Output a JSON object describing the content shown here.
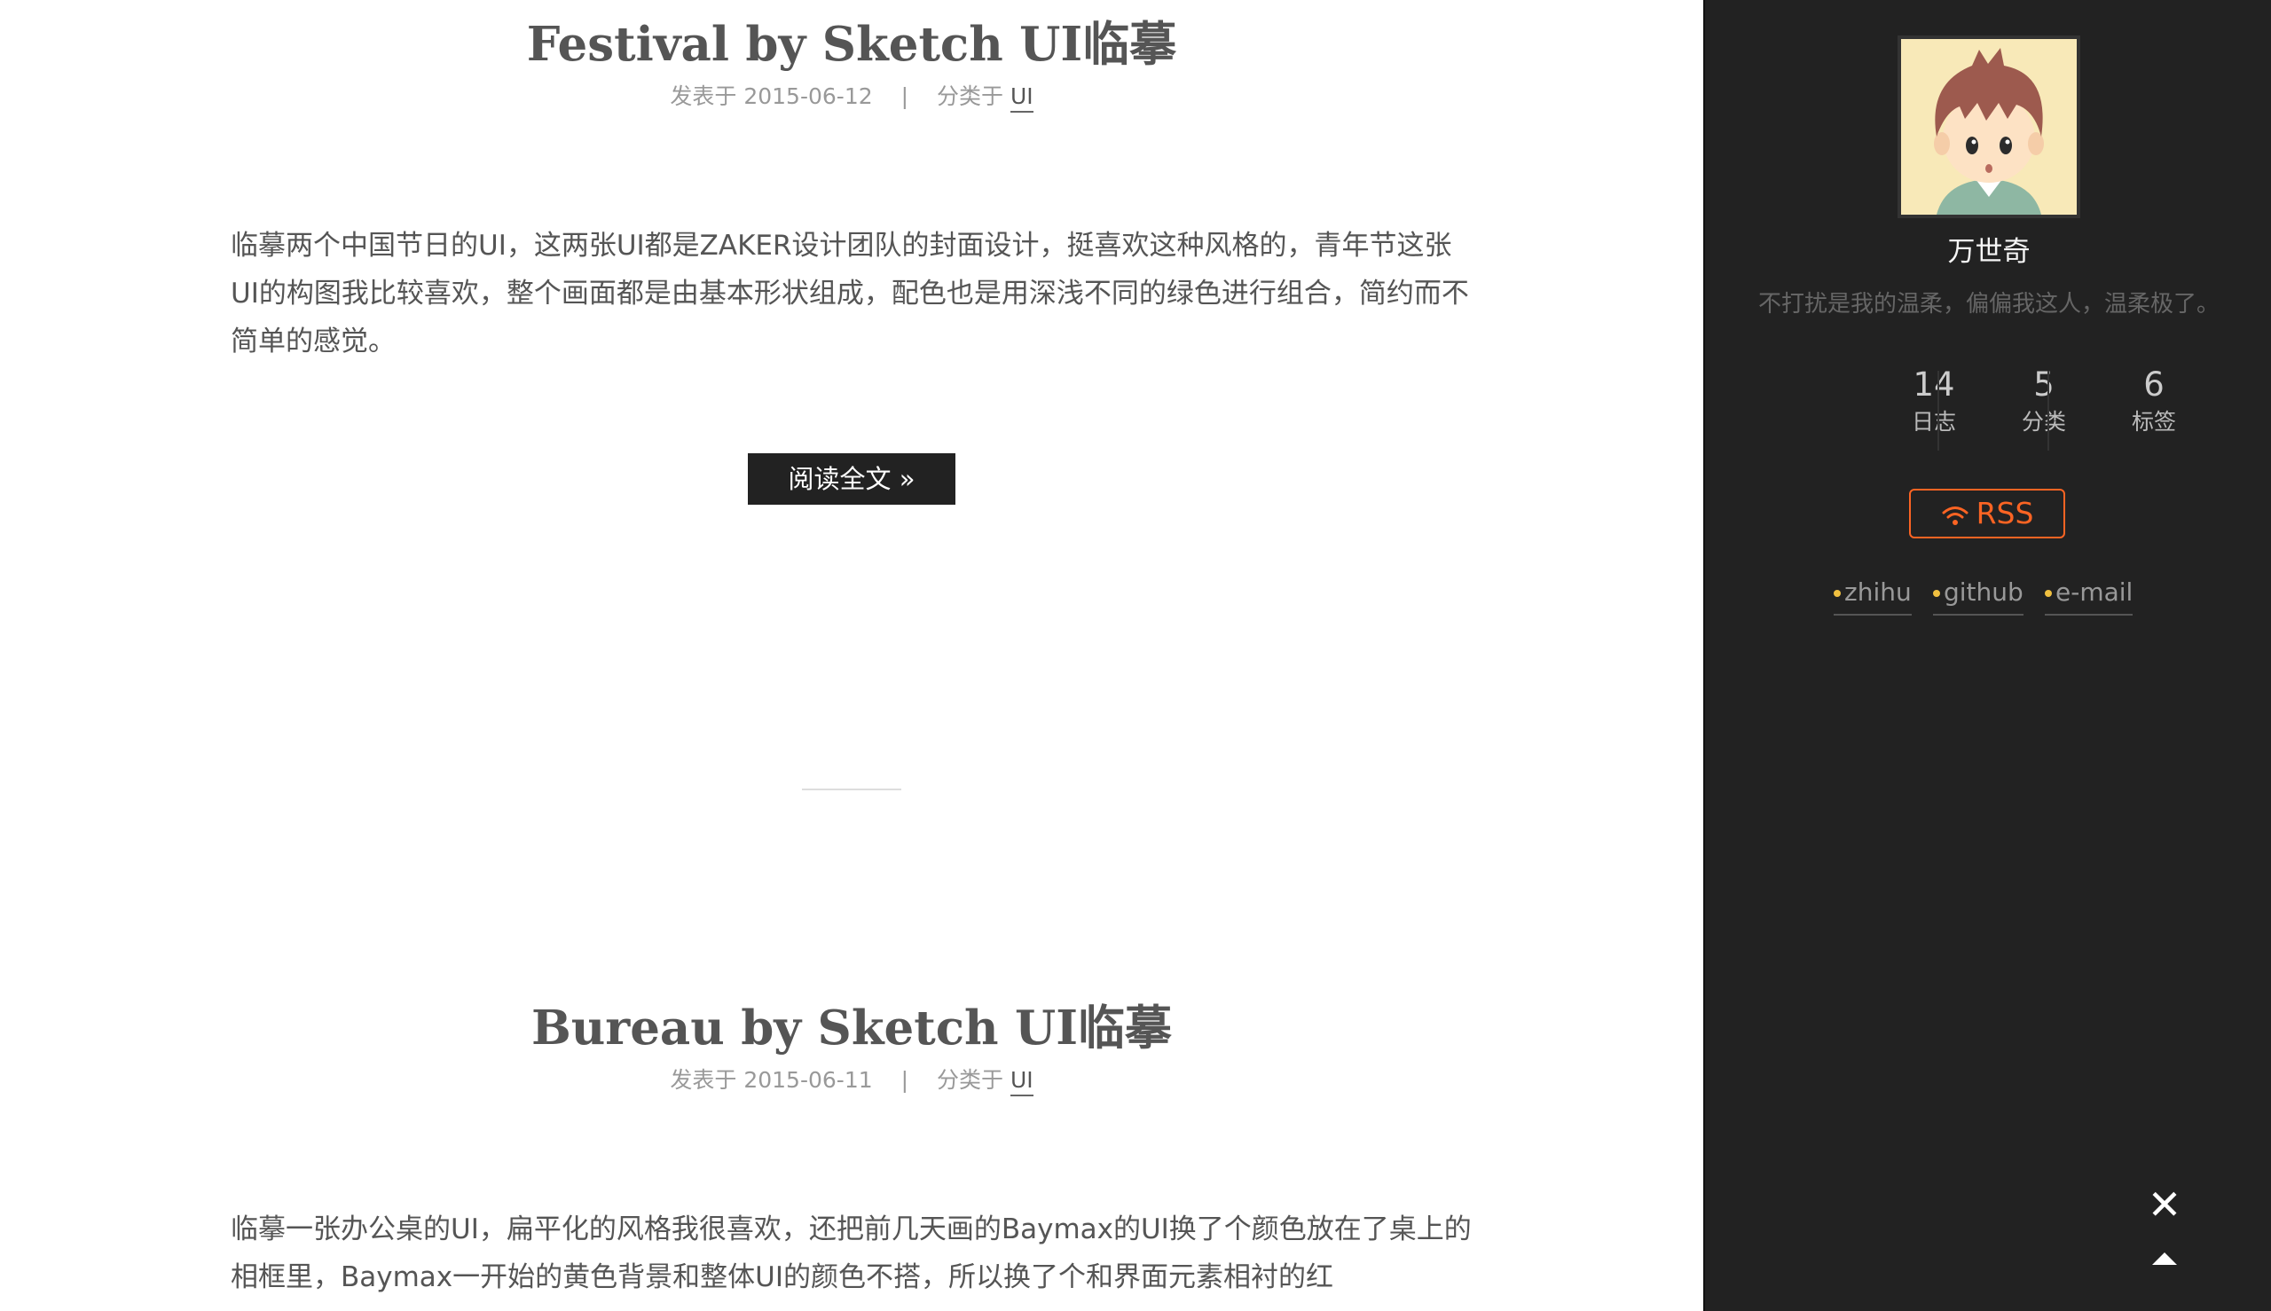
{
  "posts": [
    {
      "title": "Festival by Sketch UI临摹",
      "meta_prefix": "发表于",
      "date": "2015-06-12",
      "meta_sep": "|",
      "category_prefix": "分类于",
      "category": "UI",
      "body": "临摹两个中国节日的UI，这两张UI都是ZAKER设计团队的封面设计，挺喜欢这种风格的，青年节这张UI的构图我比较喜欢，整个画面都是由基本形状组成，配色也是用深浅不同的绿色进行组合，简约而不简单的感觉。",
      "read_more": "阅读全文 »"
    },
    {
      "title": "Bureau by Sketch UI临摹",
      "meta_prefix": "发表于",
      "date": "2015-06-11",
      "meta_sep": "|",
      "category_prefix": "分类于",
      "category": "UI",
      "body": "临摹一张办公桌的UI，扁平化的风格我很喜欢，还把前几天画的Baymax的UI换了个颜色放在了桌上的相框里，Baymax一开始的黄色背景和整体UI的颜色不搭，所以换了个和界面元素相衬的红"
    }
  ],
  "sidebar": {
    "author_name": "万世奇",
    "author_desc": "不打扰是我的温柔，偏偏我这人，温柔极了。",
    "stats": [
      {
        "num": "14",
        "label": "日志"
      },
      {
        "num": "5",
        "label": "分类"
      },
      {
        "num": "6",
        "label": "标签"
      }
    ],
    "rss_label": "RSS",
    "links": [
      "zhihu",
      "github",
      "e-mail"
    ],
    "close_icon": "close-icon",
    "back_to_top_icon": "arrow-up-icon"
  },
  "colors": {
    "background": "#ffffff",
    "sidebar_bg": "#222222",
    "text": "#555555",
    "meta": "#999999",
    "button_bg": "#222222",
    "rss": "#fc6423",
    "link_dot": "#f0c040"
  }
}
